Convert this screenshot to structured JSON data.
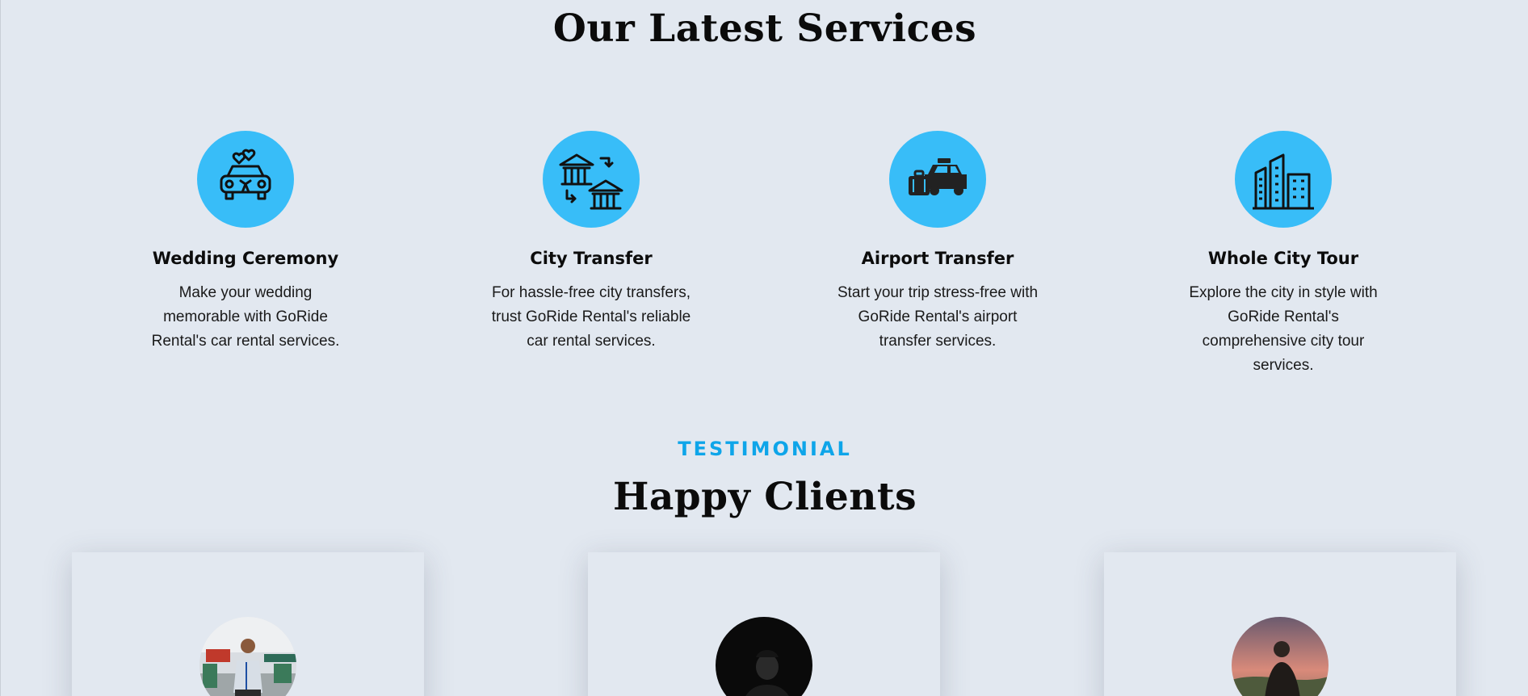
{
  "services": {
    "title": "Our Latest Services",
    "accent_color": "#38bdf8",
    "items": [
      {
        "icon": "wedding-car-icon",
        "title": "Wedding Ceremony",
        "description": "Make your wedding memorable with GoRide Rental's car rental services."
      },
      {
        "icon": "city-transfer-icon",
        "title": "City Transfer",
        "description": "For hassle-free city transfers, trust GoRide Rental's reliable car rental services."
      },
      {
        "icon": "airport-taxi-icon",
        "title": "Airport Transfer",
        "description": "Start your trip stress-free with GoRide Rental's airport transfer services."
      },
      {
        "icon": "city-buildings-icon",
        "title": "Whole City Tour",
        "description": "Explore the city in style with GoRide Rental's comprehensive city tour services."
      }
    ]
  },
  "testimonials": {
    "eyebrow": "TESTIMONIAL",
    "eyebrow_color": "#0ea5e9",
    "title": "Happy Clients",
    "cards": [
      {
        "avatar": "client-photo-1"
      },
      {
        "avatar": "client-photo-2"
      },
      {
        "avatar": "client-photo-3"
      }
    ]
  }
}
